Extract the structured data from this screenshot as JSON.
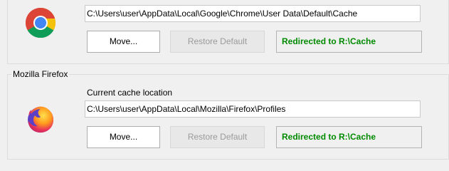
{
  "chrome": {
    "icon": "chrome-icon",
    "path": "C:\\Users\\user\\AppData\\Local\\Google\\Chrome\\User Data\\Default\\Cache",
    "move_label": "Move...",
    "restore_label": "Restore Default",
    "status": "Redirected to R:\\Cache"
  },
  "firefox": {
    "group_title": "Mozilla Firefox",
    "icon": "firefox-icon",
    "cache_label": "Current cache location",
    "path": "C:\\Users\\user\\AppData\\Local\\Mozilla\\Firefox\\Profiles",
    "move_label": "Move...",
    "restore_label": "Restore Default",
    "status": "Redirected to R:\\Cache"
  },
  "colors": {
    "status_green": "#008a00",
    "background": "#f0f0f0"
  }
}
